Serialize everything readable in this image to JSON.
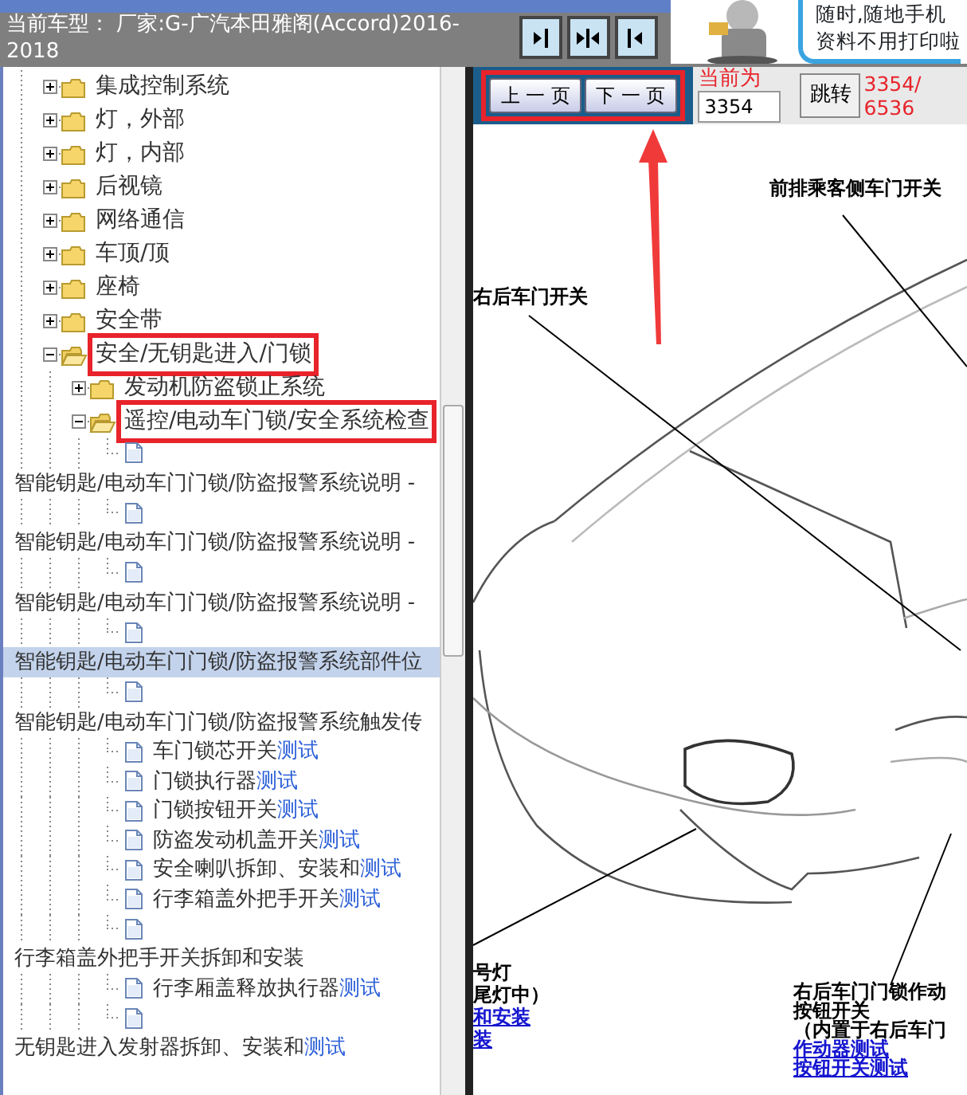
{
  "header": {
    "title": "当前车型： 厂家:G-广汽本田雅阁(Accord)2016-2018"
  },
  "ad": {
    "lines": [
      "随时,随地手机",
      "资料不用打印啦"
    ]
  },
  "tree": [
    {
      "label": "集成控制系统",
      "kind": "folder",
      "expanded": false,
      "annotated": false
    },
    {
      "label": "灯，外部",
      "kind": "folder",
      "expanded": false,
      "annotated": false
    },
    {
      "label": "灯，内部",
      "kind": "folder",
      "expanded": false,
      "annotated": false
    },
    {
      "label": "后视镜",
      "kind": "folder",
      "expanded": false,
      "annotated": false
    },
    {
      "label": "网络通信",
      "kind": "folder",
      "expanded": false,
      "annotated": false
    },
    {
      "label": "车顶/顶",
      "kind": "folder",
      "expanded": false,
      "annotated": false
    },
    {
      "label": "座椅",
      "kind": "folder",
      "expanded": false,
      "annotated": false
    },
    {
      "label": "安全带",
      "kind": "folder",
      "expanded": false,
      "annotated": false
    },
    {
      "label": "安全/无钥匙进入/门锁",
      "kind": "folder",
      "expanded": true,
      "annotated": true,
      "children": [
        {
          "label": "发动机防盗锁止系统",
          "kind": "folder",
          "expanded": false,
          "annotated": false
        },
        {
          "label": "遥控/电动车门锁/安全系统检查",
          "kind": "folder",
          "expanded": true,
          "annotated": true,
          "children": [
            {
              "label": "智能钥匙/电动车门门锁/防盗报警系统说明 -",
              "kind": "doc-wrapped",
              "selected": false
            },
            {
              "label": "智能钥匙/电动车门门锁/防盗报警系统说明 -",
              "kind": "doc-wrapped",
              "selected": false
            },
            {
              "label": "智能钥匙/电动车门门锁/防盗报警系统说明 -",
              "kind": "doc-wrapped",
              "selected": false
            },
            {
              "label": "智能钥匙/电动车门门锁/防盗报警系统部件位",
              "kind": "doc-wrapped",
              "selected": true
            },
            {
              "label": "智能钥匙/电动车门门锁/防盗报警系统触发传",
              "kind": "doc-wrapped",
              "selected": false
            },
            {
              "label": "车门锁芯开关",
              "match": "测试",
              "kind": "doc",
              "selected": false
            },
            {
              "label": "门锁执行器",
              "match": "测试",
              "kind": "doc",
              "selected": false
            },
            {
              "label": "门锁按钮开关",
              "match": "测试",
              "kind": "doc",
              "selected": false
            },
            {
              "label": "防盗发动机盖开关",
              "match": "测试",
              "kind": "doc",
              "selected": false
            },
            {
              "label": "安全喇叭拆卸、安装和",
              "match": "测试",
              "kind": "doc",
              "selected": false
            },
            {
              "label": "行李箱盖外把手开关",
              "match": "测试",
              "kind": "doc",
              "selected": false
            },
            {
              "label": "行李箱盖外把手开关拆卸和安装",
              "kind": "doc-wrapped",
              "selected": false
            },
            {
              "label": "行李厢盖释放执行器",
              "match": "测试",
              "kind": "doc",
              "selected": false
            },
            {
              "label": "无钥匙进入发射器拆卸、安装和",
              "match": "测试",
              "kind": "doc-wrapped",
              "selected": false
            }
          ]
        }
      ]
    }
  ],
  "pager": {
    "annotated": true,
    "prev": "上 一 页",
    "next": "下 一 页",
    "current_label": "当前为",
    "page": "3354",
    "go": "跳转",
    "total": "3354/6536"
  },
  "diagram": {
    "labels": [
      {
        "text": "前排乘客侧车门开关",
        "kind": "text"
      },
      {
        "text": "右后车门开关",
        "kind": "text"
      },
      {
        "text": "号灯",
        "kind": "text"
      },
      {
        "text": "尾灯中）",
        "kind": "text"
      },
      {
        "text": "和安装",
        "kind": "link"
      },
      {
        "text": "装",
        "kind": "link"
      },
      {
        "text": "右后车门门锁作动",
        "kind": "text"
      },
      {
        "text": "按钮开关",
        "kind": "text"
      },
      {
        "text": "（内置于右后车门",
        "kind": "text"
      },
      {
        "text": "作动器测试",
        "kind": "link"
      },
      {
        "text": "按钮开关测试",
        "kind": "link"
      }
    ]
  }
}
